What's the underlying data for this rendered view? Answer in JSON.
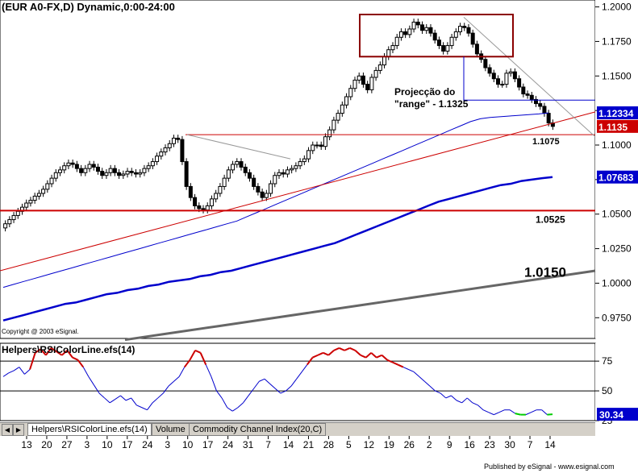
{
  "chart_title": "(EUR A0-FX,D) Dynamic,0:00-24:00",
  "copyright": "Copyright @ 2003 eSignal.",
  "publisher": "Published by eSignal - www.esignal.com",
  "colors": {
    "up_candle": "#ffffff",
    "down_candle": "#000000",
    "ma_fast": "#0000cc",
    "ma_mid": "#0000cc",
    "ma_slow": "#666666",
    "trend_line": "#cc0000",
    "level_line": "#cc0000",
    "box": "#8b0000",
    "rsi_up": "#cc0000",
    "rsi_mid": "#0000cc",
    "rsi_down": "#00cc00",
    "badge_bg": "#0000cc",
    "badge_red": "#cc0000"
  },
  "chart_data": [
    {
      "type": "candlestick",
      "title": "(EUR A0-FX,D) Dynamic,0:00-24:00",
      "ylim": [
        0.96,
        1.205
      ],
      "y_ticks": [
        "1.2000",
        "1.1750",
        "1.1500",
        "1.1250",
        "1.1000",
        "1.0750",
        "1.0500",
        "1.0250",
        "1.0000",
        "0.9750"
      ],
      "x_ticks": [
        "13",
        "20",
        "27",
        "3",
        "10",
        "17",
        "24",
        "3",
        "10",
        "17",
        "24",
        "31",
        "7",
        "14",
        "21",
        "28",
        "5",
        "12",
        "19",
        "26",
        "2",
        "9",
        "16",
        "23",
        "30",
        "7",
        "14"
      ],
      "closes": [
        1.043,
        1.046,
        1.049,
        1.052,
        1.055,
        1.058,
        1.06,
        1.063,
        1.065,
        1.068,
        1.072,
        1.076,
        1.08,
        1.082,
        1.085,
        1.087,
        1.086,
        1.083,
        1.08,
        1.083,
        1.086,
        1.084,
        1.081,
        1.078,
        1.08,
        1.083,
        1.08,
        1.078,
        1.079,
        1.081,
        1.08,
        1.079,
        1.08,
        1.083,
        1.085,
        1.088,
        1.092,
        1.095,
        1.098,
        1.101,
        1.105,
        1.104,
        1.088,
        1.07,
        1.062,
        1.056,
        1.054,
        1.053,
        1.056,
        1.061,
        1.065,
        1.07,
        1.076,
        1.082,
        1.086,
        1.088,
        1.084,
        1.08,
        1.076,
        1.07,
        1.066,
        1.062,
        1.065,
        1.072,
        1.078,
        1.08,
        1.079,
        1.082,
        1.083,
        1.085,
        1.088,
        1.09,
        1.096,
        1.1,
        1.1,
        1.099,
        1.106,
        1.111,
        1.118,
        1.123,
        1.129,
        1.135,
        1.141,
        1.147,
        1.15,
        1.144,
        1.14,
        1.149,
        1.154,
        1.158,
        1.164,
        1.169,
        1.172,
        1.178,
        1.182,
        1.18,
        1.184,
        1.189,
        1.187,
        1.183,
        1.185,
        1.181,
        1.176,
        1.172,
        1.168,
        1.172,
        1.178,
        1.182,
        1.186,
        1.185,
        1.181,
        1.173,
        1.166,
        1.162,
        1.156,
        1.152,
        1.148,
        1.144,
        1.144,
        1.152,
        1.153,
        1.148,
        1.142,
        1.137,
        1.136,
        1.133,
        1.13,
        1.128,
        1.123,
        1.116,
        1.1135
      ],
      "ma_fast": [
        0.997,
        0.999,
        1.001,
        1.003,
        1.005,
        1.007,
        1.009,
        1.011,
        1.013,
        1.015,
        1.017,
        1.019,
        1.021,
        1.023,
        1.025,
        1.027,
        1.029,
        1.031,
        1.033,
        1.035,
        1.037,
        1.039,
        1.041,
        1.043,
        1.045,
        1.048,
        1.051,
        1.054,
        1.057,
        1.06,
        1.063,
        1.066,
        1.069,
        1.072,
        1.075,
        1.078,
        1.081,
        1.084,
        1.087,
        1.09,
        1.093,
        1.096,
        1.099,
        1.102,
        1.105,
        1.108,
        1.111,
        1.114,
        1.117,
        1.119,
        1.12,
        1.1205,
        1.121,
        1.1215,
        1.122,
        1.1225,
        1.1233
      ],
      "ma_mid": [
        0.973,
        0.975,
        0.977,
        0.979,
        0.981,
        0.983,
        0.985,
        0.986,
        0.988,
        0.99,
        0.992,
        0.993,
        0.995,
        0.996,
        0.998,
        0.999,
        1.001,
        1.002,
        1.003,
        1.005,
        1.006,
        1.008,
        1.009,
        1.011,
        1.013,
        1.015,
        1.017,
        1.019,
        1.021,
        1.023,
        1.025,
        1.027,
        1.029,
        1.032,
        1.035,
        1.038,
        1.041,
        1.044,
        1.047,
        1.05,
        1.053,
        1.056,
        1.059,
        1.061,
        1.063,
        1.065,
        1.067,
        1.069,
        1.071,
        1.072,
        1.074,
        1.075,
        1.076,
        1.0768
      ],
      "ma_slow": [
        0.959,
        0.964,
        0.969,
        0.974,
        0.979,
        0.984,
        0.989,
        0.994,
        0.999,
        1.004,
        1.009
      ],
      "levels": [
        {
          "value": 1.1075,
          "label": "1.1075"
        },
        {
          "value": 1.0525,
          "label": "1.0525"
        },
        {
          "value": 1.015,
          "label": "1.0150"
        }
      ],
      "annotation_text_1": "Projecção do",
      "annotation_text_2": "\"range\" - 1.1325",
      "price_badges": [
        {
          "value": 1.12334,
          "label": "1.12334",
          "color": "blue"
        },
        {
          "value": 1.1135,
          "label": "1.1135",
          "color": "red"
        },
        {
          "value": 1.07683,
          "label": "1.07683",
          "color": "blue"
        }
      ]
    },
    {
      "type": "line",
      "title": "Helpers\\RSIColorLine.efs(14)",
      "ylim": [
        25,
        90
      ],
      "y_ticks": [
        "75",
        "50",
        "25"
      ],
      "values": [
        62,
        65,
        67,
        70,
        64,
        68,
        82,
        85,
        80,
        86,
        83,
        80,
        84,
        78,
        76,
        70,
        62,
        55,
        48,
        44,
        40,
        43,
        46,
        42,
        44,
        38,
        36,
        34,
        40,
        44,
        48,
        54,
        58,
        62,
        70,
        76,
        84,
        82,
        72,
        62,
        50,
        44,
        36,
        33,
        36,
        40,
        46,
        52,
        58,
        60,
        56,
        52,
        48,
        50,
        54,
        60,
        66,
        72,
        78,
        80,
        82,
        80,
        84,
        86,
        84,
        86,
        84,
        80,
        78,
        82,
        78,
        80,
        76,
        74,
        72,
        70,
        68,
        66,
        62,
        58,
        54,
        50,
        48,
        44,
        46,
        42,
        40,
        44,
        40,
        38,
        34,
        32,
        30,
        32,
        34,
        34,
        31,
        30,
        30,
        32,
        34,
        34,
        30,
        30.34
      ],
      "current": "30.34"
    }
  ],
  "tabs": [
    {
      "label": "Helpers\\RSIColorLine.efs(14)"
    },
    {
      "label": "Volume"
    },
    {
      "label": "Commodity Channel Index(20,C)"
    }
  ]
}
